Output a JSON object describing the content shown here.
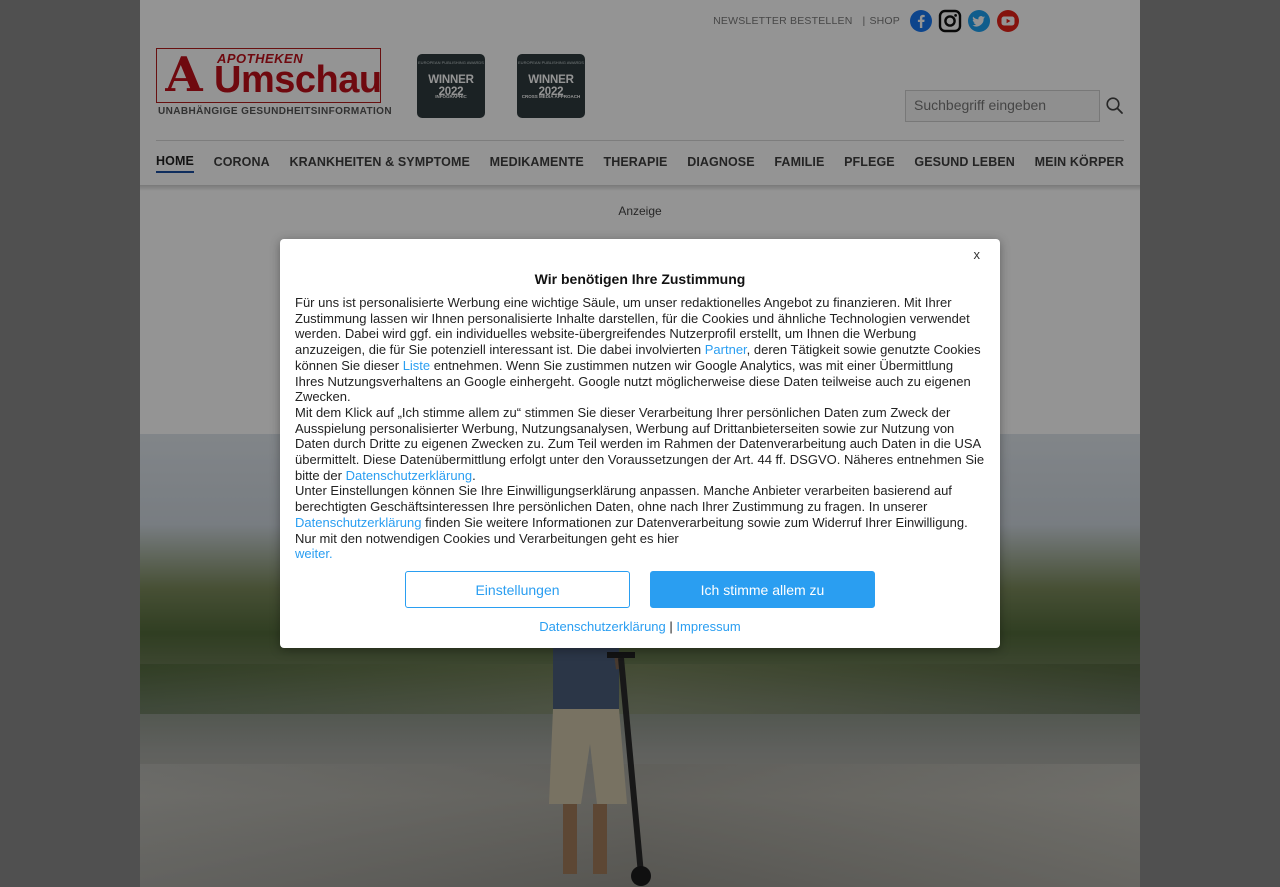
{
  "header": {
    "top_links": {
      "newsletter": "NEWSLETTER BESTELLEN",
      "separator": "|",
      "shop": "SHOP"
    },
    "social": [
      {
        "icon": "facebook-icon",
        "color": "#1877f2"
      },
      {
        "icon": "instagram-icon",
        "color": "#111111"
      },
      {
        "icon": "twitter-icon",
        "color": "#1da1f2"
      },
      {
        "icon": "youtube-icon",
        "color": "#e62117"
      }
    ],
    "logo": {
      "top": "APOTHEKEN",
      "word": "Umschau",
      "subtitle": "UNABHÄNGIGE GESUNDHEITSINFORMATION"
    },
    "awards": [
      {
        "top": "EUROPEAN PUBLISHING AWARDS",
        "title": "WINNER 2022",
        "sub": "INFOGRAPHIC"
      },
      {
        "top": "EUROPEAN PUBLISHING AWARDS",
        "title": "WINNER 2022",
        "sub": "CROSS MEDIA APPROACH"
      }
    ],
    "search": {
      "placeholder": "Suchbegriff eingeben"
    }
  },
  "nav": {
    "items": [
      "HOME",
      "CORONA",
      "KRANKHEITEN & SYMPTOME",
      "MEDIKAMENTE",
      "THERAPIE",
      "DIAGNOSE",
      "FAMILIE",
      "PFLEGE",
      "GESUND LEBEN",
      "MEIN KÖRPER"
    ],
    "active": "HOME"
  },
  "ad_label": "Anzeige",
  "consent": {
    "close": "x",
    "title": "Wir benötigen Ihre Zustimmung",
    "p1_a": "Für uns ist personalisierte Werbung eine wichtige Säule, um unser redaktionelles Angebot zu finanzieren. Mit Ihrer Zustimmung lassen wir Ihnen personalisierte Inhalte darstellen, für die Cookies und ähnliche Technologien verwendet werden. Dabei wird ggf. ein individuelles website-übergreifendes Nutzerprofil erstellt, um Ihnen die Werbung anzuzeigen, die für Sie potenziell interessant ist. Die dabei involvierten ",
    "p1_link1": "Partner",
    "p1_b": ", deren Tätigkeit sowie genutzte Cookies können Sie dieser ",
    "p1_link2": "Liste",
    "p1_c": " entnehmen. Wenn Sie zustimmen nutzen wir Google Analytics, was mit einer Übermittlung Ihres Nutzungsverhaltens an Google einhergeht. Google nutzt möglicherweise diese Daten teilweise auch zu eigenen Zwecken.",
    "p2_a": "Mit dem Klick auf „Ich stimme allem zu“ stimmen Sie dieser Verarbeitung Ihrer persönlichen Daten zum Zweck der Ausspielung personalisierter Werbung, Nutzungsanalysen, Werbung auf Drittanbieterseiten sowie zur Nutzung von Daten durch Dritte zu eigenen Zwecken zu. Zum Teil werden im Rahmen der Datenverarbeitung auch Daten in die USA übermittelt. Diese Datenübermittlung erfolgt unter den Voraussetzungen der Art. 44 ff. DSGVO. Näheres entnehmen Sie bitte der ",
    "p2_link": "Datenschutzerklärung",
    "p2_b": ".",
    "p3_a": "Unter Einstellungen können Sie Ihre Einwilligungserklärung anpassen. Manche Anbieter verarbeiten basierend auf berechtigten Geschäftsinteressen Ihre persönlichen Daten, ohne nach Ihrer Zustimmung zu fragen. In unserer ",
    "p3_link": "Datenschutzerklärung",
    "p3_b": " finden Sie weitere Informationen zur Datenverarbeitung sowie zum Widerruf Ihrer Einwilligung.",
    "p4": "Nur mit den notwendigen Cookies und Verarbeitungen geht es hier",
    "p4_link": "weiter.",
    "btn_settings": "Einstellungen",
    "btn_accept": "Ich stimme allem zu",
    "footer_privacy": "Datenschutzerklärung",
    "footer_sep": "|",
    "footer_imprint": "Impressum",
    "accent_color": "#2a9ef1"
  }
}
